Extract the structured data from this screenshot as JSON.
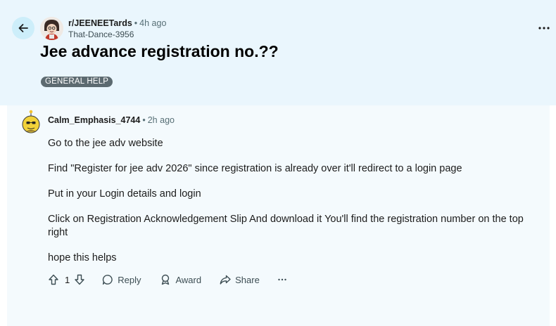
{
  "post": {
    "subreddit": "r/JEENEETards",
    "time": "4h ago",
    "author": "That-Dance-3956",
    "title": "Jee advance registration no.??",
    "flair": "GENERAL HELP"
  },
  "comment": {
    "user": "Calm_Emphasis_4744",
    "time": "2h ago",
    "paragraphs": [
      "Go to the jee adv website",
      "Find \"Register for jee adv 2026\" since registration is already over it'll redirect to a login page",
      "Put in your Login details and login",
      "Click on Registration Acknowledgement Slip And download it You'll find the registration number on the top right",
      "hope this helps"
    ],
    "votes": "1",
    "reply_label": "Reply",
    "award_label": "Award",
    "share_label": "Share"
  },
  "icons": {
    "back": "arrow-left-icon",
    "more": "more-horizontal-icon",
    "upvote": "arrow-up-icon",
    "downvote": "arrow-down-icon",
    "reply": "speech-bubble-icon",
    "award": "award-icon",
    "share": "share-arrow-icon"
  },
  "colors": {
    "header_bg": "#eaf6fd",
    "comment_bg": "#f4fafd",
    "back_button": "#cdeefa",
    "flair_bg": "#5c6a70"
  }
}
